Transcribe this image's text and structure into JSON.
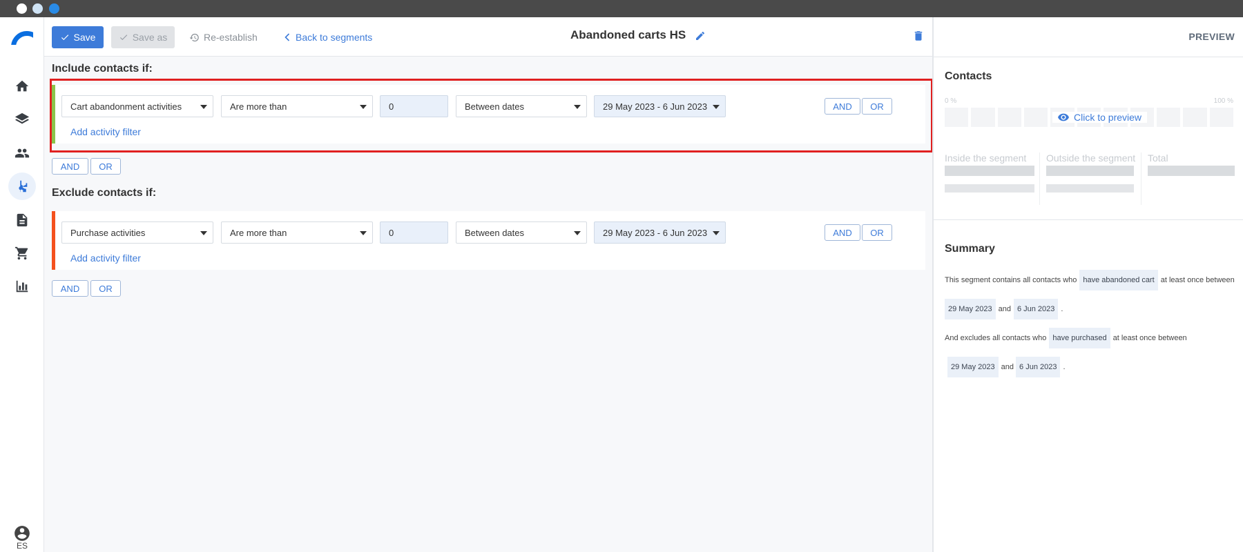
{
  "toolbar": {
    "save_label": "Save",
    "save_as_label": "Save as",
    "reestablish_label": "Re-establish",
    "back_label": "Back to segments",
    "title": "Abandoned carts HS"
  },
  "rail": {
    "items": [
      "home-icon",
      "layers-icon",
      "people-icon",
      "segments-icon",
      "document-icon",
      "cart-icon",
      "chart-icon"
    ],
    "active": "segments-icon",
    "language": "ES"
  },
  "include": {
    "heading": "Include contacts if:",
    "activity": "Cart abandonment activities",
    "comparator": "Are more than",
    "count": "0",
    "date_mode": "Between dates",
    "date_range": "29 May 2023 - 6 Jun 2023",
    "add_filter": "Add activity filter",
    "and": "AND",
    "or": "OR",
    "bar_color": "#8bc34a"
  },
  "include_join": {
    "and": "AND",
    "or": "OR"
  },
  "exclude": {
    "heading": "Exclude contacts if:",
    "activity": "Purchase activities",
    "comparator": "Are more than",
    "count": "0",
    "date_mode": "Between dates",
    "date_range": "29 May 2023 - 6 Jun 2023",
    "add_filter": "Add activity filter",
    "and": "AND",
    "or": "OR",
    "bar_color": "#f4511e"
  },
  "exclude_join": {
    "and": "AND",
    "or": "OR"
  },
  "preview": {
    "label": "PREVIEW",
    "contacts_heading": "Contacts",
    "pct_min": "0 %",
    "pct_max": "100 %",
    "click_label": "Click to preview",
    "inside_label": "Inside the segment",
    "outside_label": "Outside the segment",
    "total_label": "Total"
  },
  "summary": {
    "heading": "Summary",
    "s1_a": "This segment contains all contacts who",
    "s1_chip1": "have abandoned cart",
    "s1_b": "at least once between",
    "s1_chip2": "29 May 2023",
    "s1_c": "and",
    "s1_chip3": "6 Jun 2023",
    "s1_d": ".",
    "s2_a": "And excludes all contacts who",
    "s2_chip1": "have purchased",
    "s2_b": "at least once between",
    "s2_chip2": "29 May 2023",
    "s2_c": "and",
    "s2_chip3": "6 Jun 2023",
    "s2_d": "."
  },
  "colors": {
    "accent": "#3d7bd9",
    "highlight": "#e02020"
  }
}
